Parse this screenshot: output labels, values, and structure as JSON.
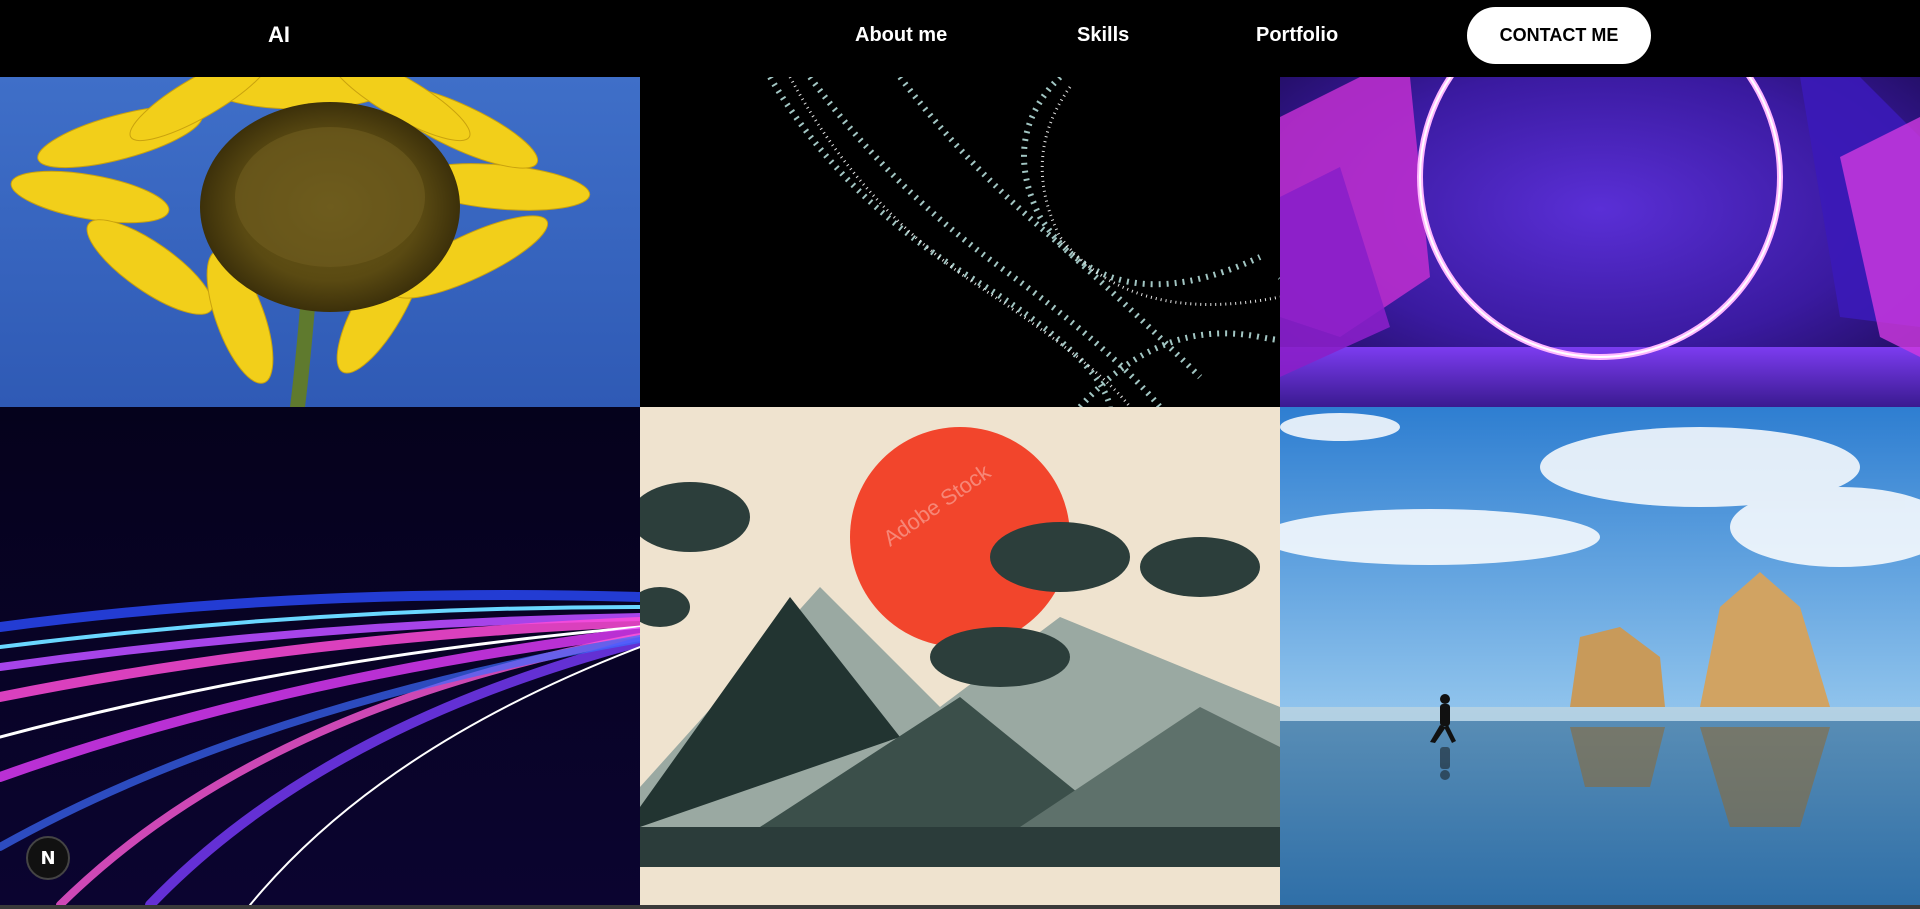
{
  "nav": {
    "logo": "AI",
    "links": [
      {
        "label": "About me"
      },
      {
        "label": "Skills"
      },
      {
        "label": "Portfolio"
      }
    ],
    "contact_label": "CONTACT ME"
  },
  "gallery": {
    "tiles": [
      {
        "subject": "sunflower"
      },
      {
        "subject": "particle-swirl"
      },
      {
        "subject": "neon-ring-crystals"
      },
      {
        "subject": "light-streaks"
      },
      {
        "subject": "japanese-mountains-sun",
        "watermark": "Adobe Stock"
      },
      {
        "subject": "beach-runner-rocks"
      }
    ]
  },
  "dev_badge": {
    "letter": "N"
  },
  "colors": {
    "nav_bg": "#000000",
    "contact_bg": "#ffffff",
    "contact_text": "#000000"
  }
}
